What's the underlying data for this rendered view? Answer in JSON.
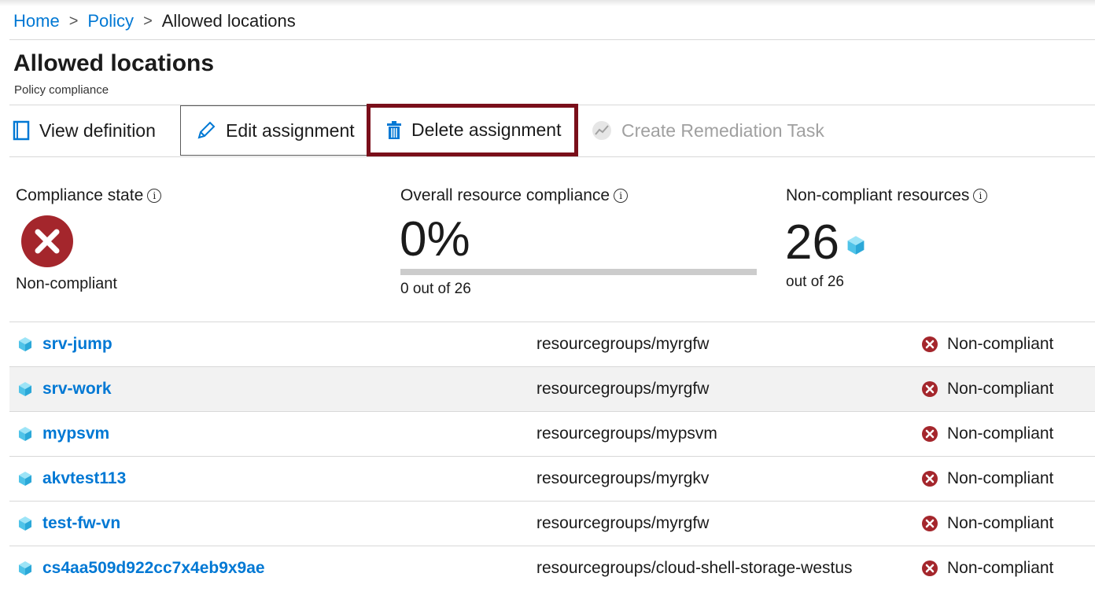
{
  "breadcrumb": {
    "home": "Home",
    "policy": "Policy",
    "current": "Allowed locations"
  },
  "header": {
    "title": "Allowed locations",
    "subtitle": "Policy compliance"
  },
  "toolbar": {
    "view_definition": "View definition",
    "edit_assignment": "Edit assignment",
    "delete_assignment": "Delete assignment",
    "create_remediation": "Create Remediation Task"
  },
  "summary": {
    "compliance_state_label": "Compliance state",
    "compliance_state_value": "Non-compliant",
    "overall_label": "Overall resource compliance",
    "overall_percent": "0%",
    "overall_progress": 0,
    "overall_sub": "0 out of 26",
    "noncompliant_label": "Non-compliant resources",
    "noncompliant_count": "26",
    "noncompliant_sub": "out of 26"
  },
  "resources": [
    {
      "name": "srv-jump",
      "group": "resourcegroups/myrgfw",
      "status": "Non-compliant"
    },
    {
      "name": "srv-work",
      "group": "resourcegroups/myrgfw",
      "status": "Non-compliant"
    },
    {
      "name": "mypsvm",
      "group": "resourcegroups/mypsvm",
      "status": "Non-compliant"
    },
    {
      "name": "akvtest113",
      "group": "resourcegroups/myrgkv",
      "status": "Non-compliant"
    },
    {
      "name": "test-fw-vn",
      "group": "resourcegroups/myrgfw",
      "status": "Non-compliant"
    },
    {
      "name": "cs4aa509d922cc7x4eb9x9ae",
      "group": "resourcegroups/cloud-shell-storage-westus",
      "status": "Non-compliant"
    }
  ],
  "colors": {
    "link": "#0078d4",
    "error": "#a4262c",
    "highlight_border": "#7a0f1a",
    "cube": "#4fc3e8"
  }
}
